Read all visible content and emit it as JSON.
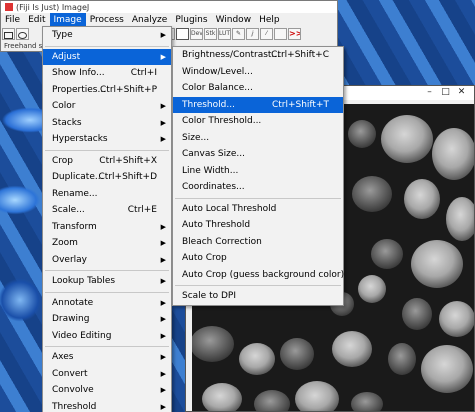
{
  "window": {
    "title": "(Fiji Is Just) ImageJ"
  },
  "menubar": [
    "File",
    "Edit",
    "Image",
    "Process",
    "Analyze",
    "Plugins",
    "Window",
    "Help"
  ],
  "toolbar": {
    "dev": "Dev",
    "stk": "Stk",
    "lut": "LUT",
    "more": ">>"
  },
  "status": "Freehand sel",
  "image_menu": {
    "items": [
      {
        "label": "Type",
        "submenu": true
      },
      {
        "sep": true
      },
      {
        "label": "Adjust",
        "submenu": true,
        "highlight": true
      },
      {
        "label": "Show Info...",
        "shortcut": "Ctrl+I"
      },
      {
        "label": "Properties...",
        "shortcut": "Ctrl+Shift+P"
      },
      {
        "label": "Color",
        "submenu": true
      },
      {
        "label": "Stacks",
        "submenu": true
      },
      {
        "label": "Hyperstacks",
        "submenu": true
      },
      {
        "sep": true
      },
      {
        "label": "Crop",
        "shortcut": "Ctrl+Shift+X"
      },
      {
        "label": "Duplicate...",
        "shortcut": "Ctrl+Shift+D"
      },
      {
        "label": "Rename..."
      },
      {
        "label": "Scale...",
        "shortcut": "Ctrl+E"
      },
      {
        "label": "Transform",
        "submenu": true
      },
      {
        "label": "Zoom",
        "submenu": true
      },
      {
        "label": "Overlay",
        "submenu": true
      },
      {
        "sep": true
      },
      {
        "label": "Lookup Tables",
        "submenu": true
      },
      {
        "sep": true
      },
      {
        "label": "Annotate",
        "submenu": true
      },
      {
        "label": "Drawing",
        "submenu": true
      },
      {
        "label": "Video Editing",
        "submenu": true
      },
      {
        "sep": true
      },
      {
        "label": "Axes",
        "submenu": true
      },
      {
        "label": "Convert",
        "submenu": true
      },
      {
        "label": "Convolve",
        "submenu": true
      },
      {
        "label": "Threshold",
        "submenu": true
      }
    ]
  },
  "adjust_menu": {
    "items": [
      {
        "label": "Brightness/Contrast...",
        "shortcut": "Ctrl+Shift+C"
      },
      {
        "label": "Window/Level..."
      },
      {
        "label": "Color Balance..."
      },
      {
        "label": "Threshold...",
        "shortcut": "Ctrl+Shift+T",
        "highlight": true
      },
      {
        "label": "Color Threshold..."
      },
      {
        "label": "Size..."
      },
      {
        "label": "Canvas Size..."
      },
      {
        "label": "Line Width..."
      },
      {
        "label": "Coordinates..."
      },
      {
        "sep": true
      },
      {
        "label": "Auto Local Threshold"
      },
      {
        "label": "Auto Threshold"
      },
      {
        "label": "Bleach Correction"
      },
      {
        "label": "Auto Crop"
      },
      {
        "label": "Auto Crop (guess background color)"
      },
      {
        "sep": true
      },
      {
        "label": "Scale to DPI"
      }
    ]
  },
  "colors": {
    "highlight": "#0a64d8",
    "menu_bg": "#f2f2f2",
    "image_bg": "#1a1a1a"
  }
}
